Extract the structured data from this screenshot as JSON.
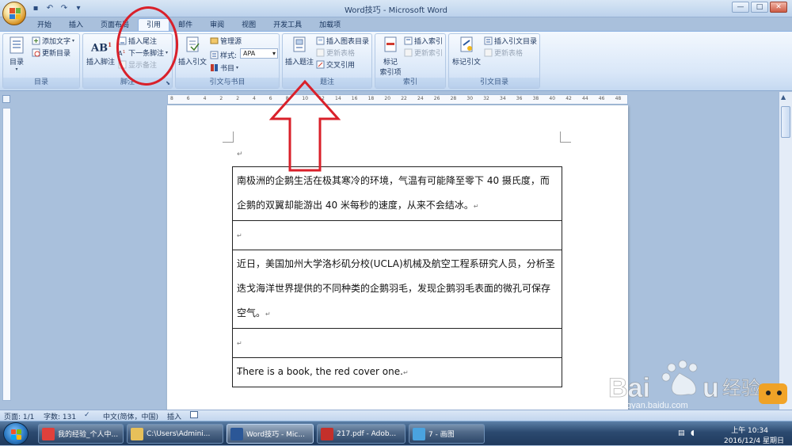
{
  "window": {
    "title": "Word技巧 - Microsoft Word",
    "controls": {
      "minimize": "—",
      "maximize": "□",
      "close": "✕"
    }
  },
  "quick_access": [
    {
      "icon": "save-icon",
      "glyph": "▪"
    },
    {
      "icon": "undo-icon",
      "glyph": "↶"
    },
    {
      "icon": "redo-icon",
      "glyph": "↷"
    },
    {
      "icon": "customize-icon",
      "glyph": "▾"
    }
  ],
  "tabs": [
    {
      "label": "开始",
      "active": false
    },
    {
      "label": "插入",
      "active": false
    },
    {
      "label": "页面布局",
      "active": false
    },
    {
      "label": "引用",
      "active": true
    },
    {
      "label": "邮件",
      "active": false
    },
    {
      "label": "审阅",
      "active": false
    },
    {
      "label": "视图",
      "active": false
    },
    {
      "label": "开发工具",
      "active": false
    },
    {
      "label": "加载项",
      "active": false
    }
  ],
  "ribbon": {
    "toc": {
      "label": "目录",
      "big_button": "目录",
      "add_text": "添加文字",
      "update_toc": "更新目录"
    },
    "footnotes": {
      "label": "脚注",
      "insert_footnote": "插入脚注",
      "insert_endnote": "插入尾注",
      "next_footnote": "下一条脚注",
      "show_notes": "显示备注",
      "icon_text": "AB",
      "icon_sup": "1"
    },
    "citations": {
      "label": "引文与书目",
      "insert_citation": "插入引文",
      "manage_sources": "管理源",
      "style_label": "样式:",
      "style_value": "APA",
      "bibliography": "书目"
    },
    "captions": {
      "label": "题注",
      "insert_caption": "插入题注",
      "insert_table_of_figures": "插入图表目录",
      "update_table": "更新表格",
      "cross_reference": "交叉引用"
    },
    "index": {
      "label": "索引",
      "mark_entry": "标记\n索引项",
      "insert_index": "插入索引",
      "update_index": "更新索引"
    },
    "toa": {
      "label": "引文目录",
      "mark_citation": "标记引文",
      "insert_toa": "插入引文目录",
      "update_table": "更新表格"
    }
  },
  "ruler_numbers": [
    "8",
    "6",
    "4",
    "2",
    "2",
    "4",
    "6",
    "8",
    "10",
    "12",
    "14",
    "16",
    "18",
    "20",
    "22",
    "24",
    "26",
    "28",
    "30",
    "32",
    "34",
    "36",
    "38",
    "40",
    "42",
    "44",
    "46",
    "48"
  ],
  "document": {
    "cursor_mark": "↵",
    "rows": [
      {
        "text": "南极洲的企鹅生活在极其寒冷的环境，气温有可能降至零下 40 摄氏度，而企鹅的双翼却能游出 40 米每秒的速度，从来不会结冰。",
        "mark": "↵"
      },
      {
        "text": "",
        "mark": "↵"
      },
      {
        "text": "近日，美国加州大学洛杉矶分校(UCLA)机械及航空工程系研究人员，分析圣迭戈海洋世界提供的不同种类的企鹅羽毛，发现企鹅羽毛表面的微孔可保存空气。",
        "mark": "↵"
      },
      {
        "text": "",
        "mark": "↵"
      },
      {
        "text": "There is a book, the red cover one.",
        "mark": "↵"
      }
    ],
    "end_mark": "↵"
  },
  "status_bar": {
    "page": "页面: 1/1",
    "words": "字数: 131",
    "language": "中文(简体，中国)",
    "mode": "插入"
  },
  "taskbar": {
    "items": [
      {
        "label": "我的经验_个人中...",
        "color": "#e0403b",
        "active": false
      },
      {
        "label": "C:\\Users\\Admini...",
        "color": "#e7c05a",
        "active": false
      },
      {
        "label": "Word技巧 - Mic...",
        "color": "#2b5797",
        "active": true
      },
      {
        "label": "217.pdf - Adob...",
        "color": "#c4302b",
        "active": false
      },
      {
        "label": "7 - 画图",
        "color": "#4aa3df",
        "active": false
      }
    ],
    "time": "上午 10:34",
    "date": "2016/12/4 星期日"
  },
  "watermark": {
    "brand": "Baidu",
    "suffix": "经验",
    "url": "jingyan.baidu.com"
  },
  "colors": {
    "annotation_red": "#d9202a",
    "ribbon_bg": "#dbe8f8",
    "title_text": "#253f66"
  }
}
